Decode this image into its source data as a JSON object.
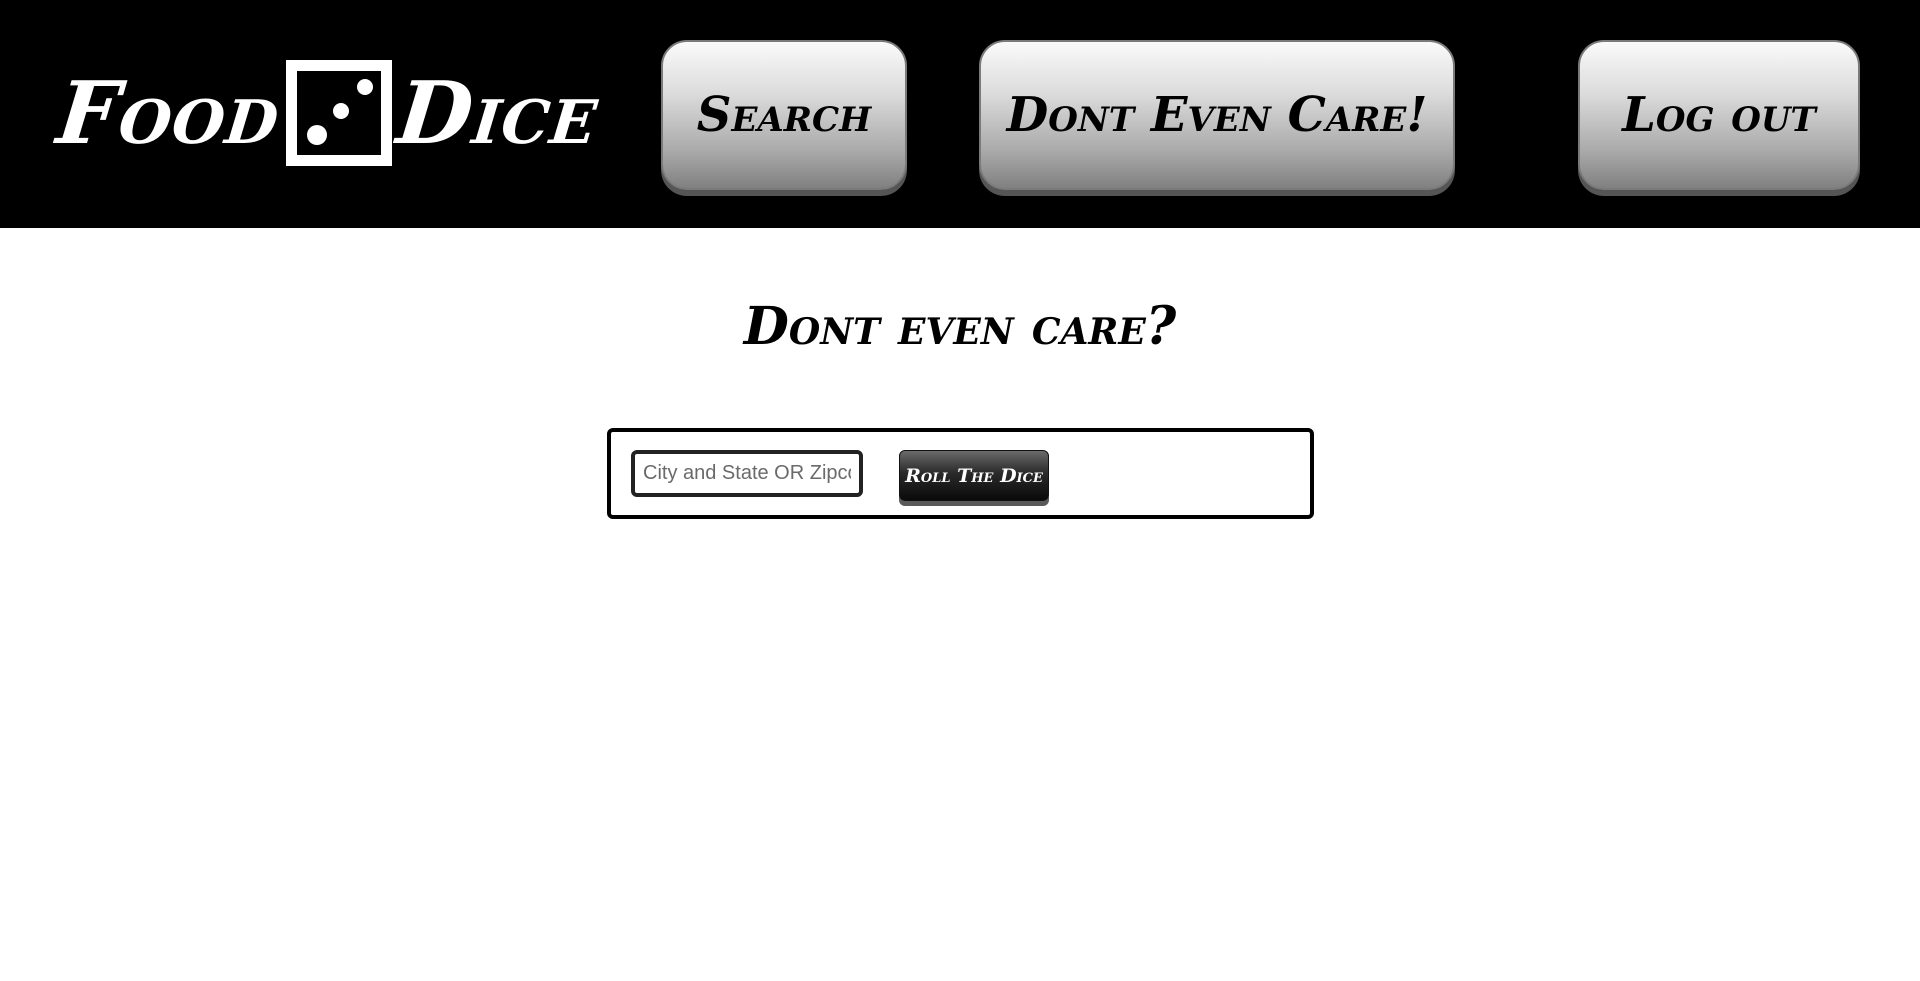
{
  "header": {
    "logo": {
      "word_left": "Food",
      "word_right": "Dice",
      "icon": "dice-three-icon"
    },
    "nav": {
      "search_label": "Search",
      "dont_care_label": "Dont Even Care!",
      "logout_label": "Log out"
    }
  },
  "main": {
    "title": "Dont even care?",
    "location_input": {
      "value": "",
      "placeholder": "City and State OR Zipcode"
    },
    "roll_button_label": "Roll The Dice"
  },
  "colors": {
    "header_background": "#000000",
    "page_background": "#ffffff",
    "text": "#000000"
  }
}
